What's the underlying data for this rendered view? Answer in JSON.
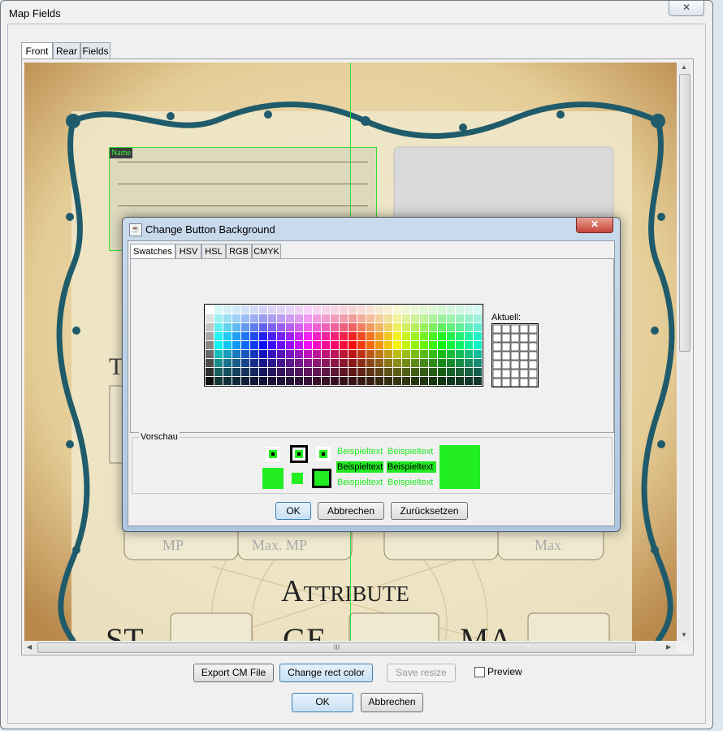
{
  "window": {
    "title": "Map Fields",
    "close_glyph": "✕"
  },
  "tabs": [
    {
      "label": "Front"
    },
    {
      "label": "Rear"
    },
    {
      "label": "Fields"
    }
  ],
  "canvas": {
    "field_label": "Name",
    "bg_texts": {
      "t": "T",
      "mp": "MP",
      "maxmp": "Max. MP",
      "max": "Max",
      "attribute": "Attribute",
      "st": "ST",
      "ge": "GE",
      "ma": "MA"
    },
    "rect_color": "#33dd33"
  },
  "toolbar": {
    "export": "Export CM File",
    "change_rect": "Change rect color",
    "save_resize": "Save resize",
    "preview": "Preview"
  },
  "footer": {
    "ok": "OK",
    "cancel": "Abbrechen"
  },
  "scroll_grip": "III",
  "dialog": {
    "title": "Change Button Background",
    "close_glyph": "✕",
    "tabs": [
      {
        "label": "Swatches"
      },
      {
        "label": "HSV"
      },
      {
        "label": "HSL"
      },
      {
        "label": "RGB"
      },
      {
        "label": "CMYK"
      }
    ],
    "recent_label": "Aktuell:",
    "preview_label": "Vorschau",
    "sample_text": "Beispieltext",
    "preview_color": "#22ee22",
    "buttons": {
      "ok": "OK",
      "cancel": "Abbrechen",
      "reset": "Zurücksetzen"
    }
  }
}
